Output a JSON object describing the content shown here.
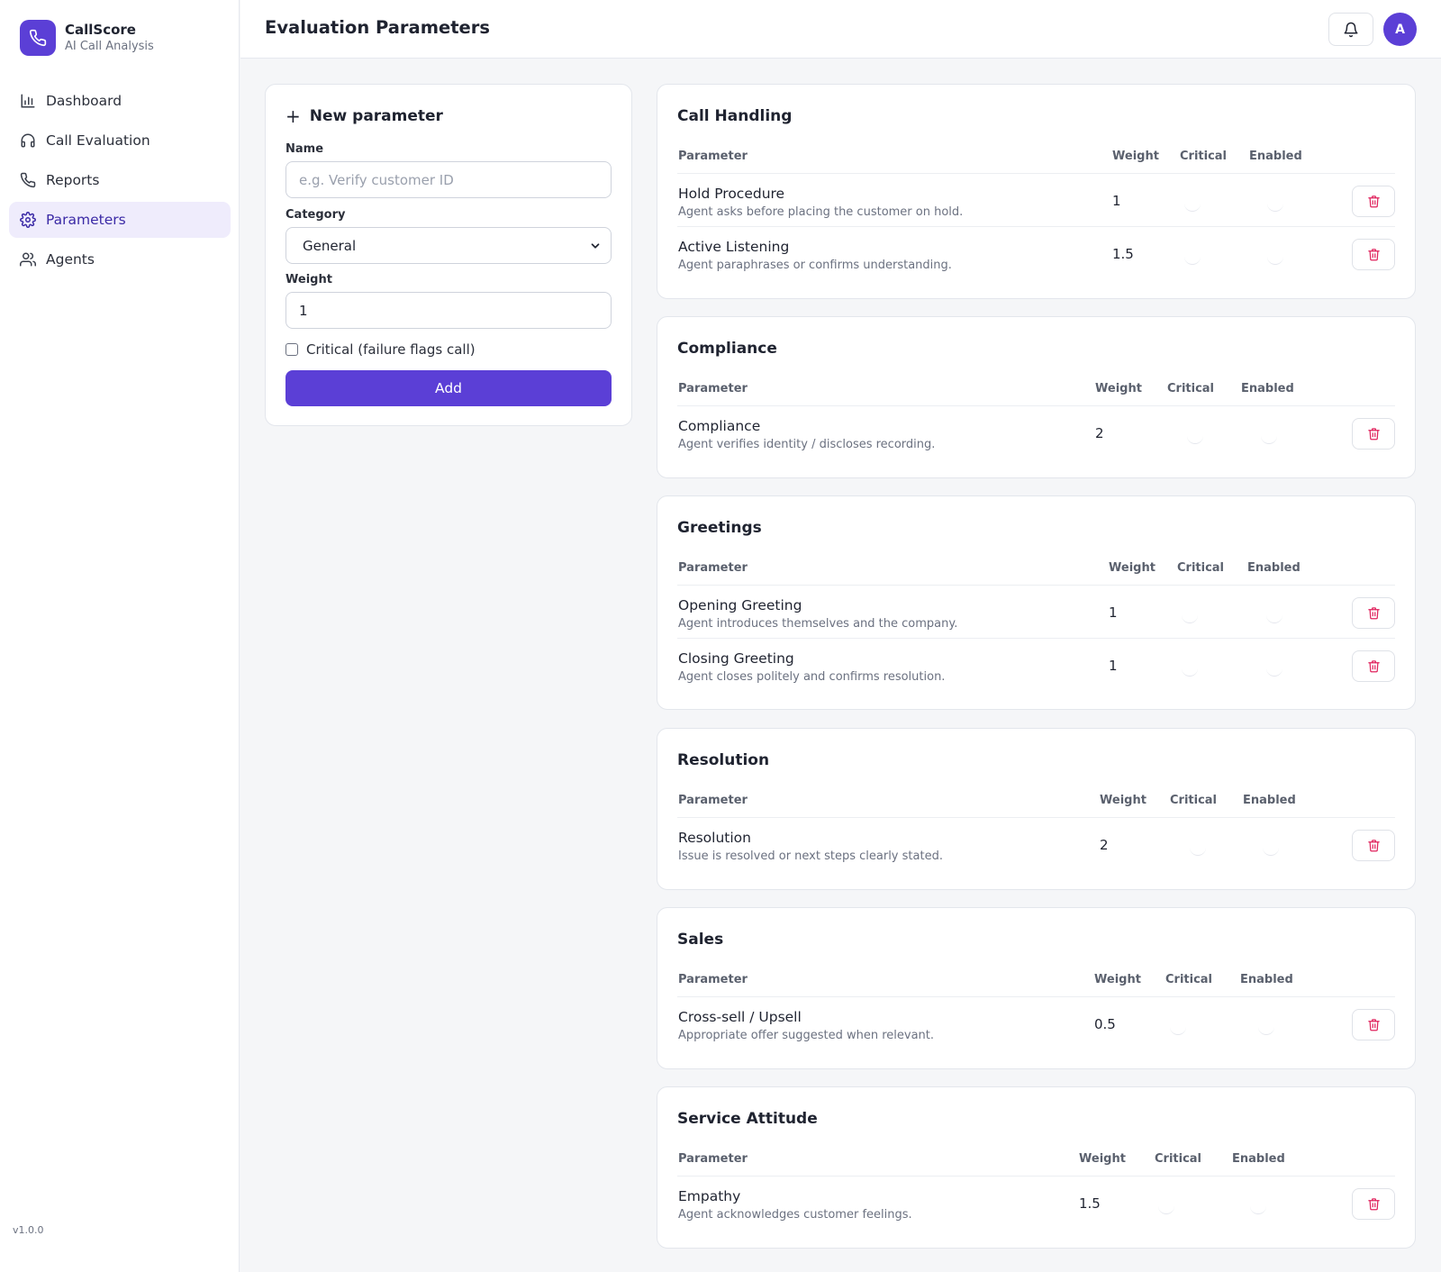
{
  "app": {
    "name": "CallScore",
    "subtitle": "AI Call Analysis",
    "version": "v1.0.0"
  },
  "nav": [
    {
      "label": "Dashboard",
      "icon": "bar-chart-icon",
      "active": false
    },
    {
      "label": "Call Evaluation",
      "icon": "headset-icon",
      "active": false
    },
    {
      "label": "Reports",
      "icon": "phone-icon",
      "active": false
    },
    {
      "label": "Parameters",
      "icon": "gear-icon",
      "active": true
    },
    {
      "label": "Agents",
      "icon": "users-icon",
      "active": false
    }
  ],
  "header": {
    "title": "Evaluation Parameters",
    "avatar_initial": "A"
  },
  "form": {
    "title": "New parameter",
    "name_label": "Name",
    "name_placeholder": "e.g. Verify customer ID",
    "category_label": "Category",
    "category_value": "General",
    "weight_label": "Weight",
    "weight_value": "1",
    "critical_label": "Critical (failure flags call)",
    "add_label": "Add"
  },
  "columns": {
    "parameter": "Parameter",
    "weight": "Weight",
    "critical": "Critical",
    "enabled": "Enabled"
  },
  "categories": [
    {
      "title": "Call Handling",
      "rows": [
        {
          "name": "Hold Procedure",
          "desc": "Agent asks before placing the customer on hold.",
          "weight": "1"
        },
        {
          "name": "Active Listening",
          "desc": "Agent paraphrases or confirms understanding.",
          "weight": "1.5"
        }
      ]
    },
    {
      "title": "Compliance",
      "rows": [
        {
          "name": "Compliance",
          "desc": "Agent verifies identity / discloses recording.",
          "weight": "2"
        }
      ]
    },
    {
      "title": "Greetings",
      "rows": [
        {
          "name": "Opening Greeting",
          "desc": "Agent introduces themselves and the company.",
          "weight": "1"
        },
        {
          "name": "Closing Greeting",
          "desc": "Agent closes politely and confirms resolution.",
          "weight": "1"
        }
      ]
    },
    {
      "title": "Resolution",
      "rows": [
        {
          "name": "Resolution",
          "desc": "Issue is resolved or next steps clearly stated.",
          "weight": "2"
        }
      ]
    },
    {
      "title": "Sales",
      "rows": [
        {
          "name": "Cross-sell / Upsell",
          "desc": "Appropriate offer suggested when relevant.",
          "weight": "0.5"
        }
      ]
    },
    {
      "title": "Service Attitude",
      "rows": [
        {
          "name": "Empathy",
          "desc": "Agent acknowledges customer feelings.",
          "weight": "1.5"
        }
      ]
    }
  ],
  "colors": {
    "accent": "#5b3fd6",
    "active_nav_bg": "#efecfc",
    "delete": "#e0245e"
  }
}
